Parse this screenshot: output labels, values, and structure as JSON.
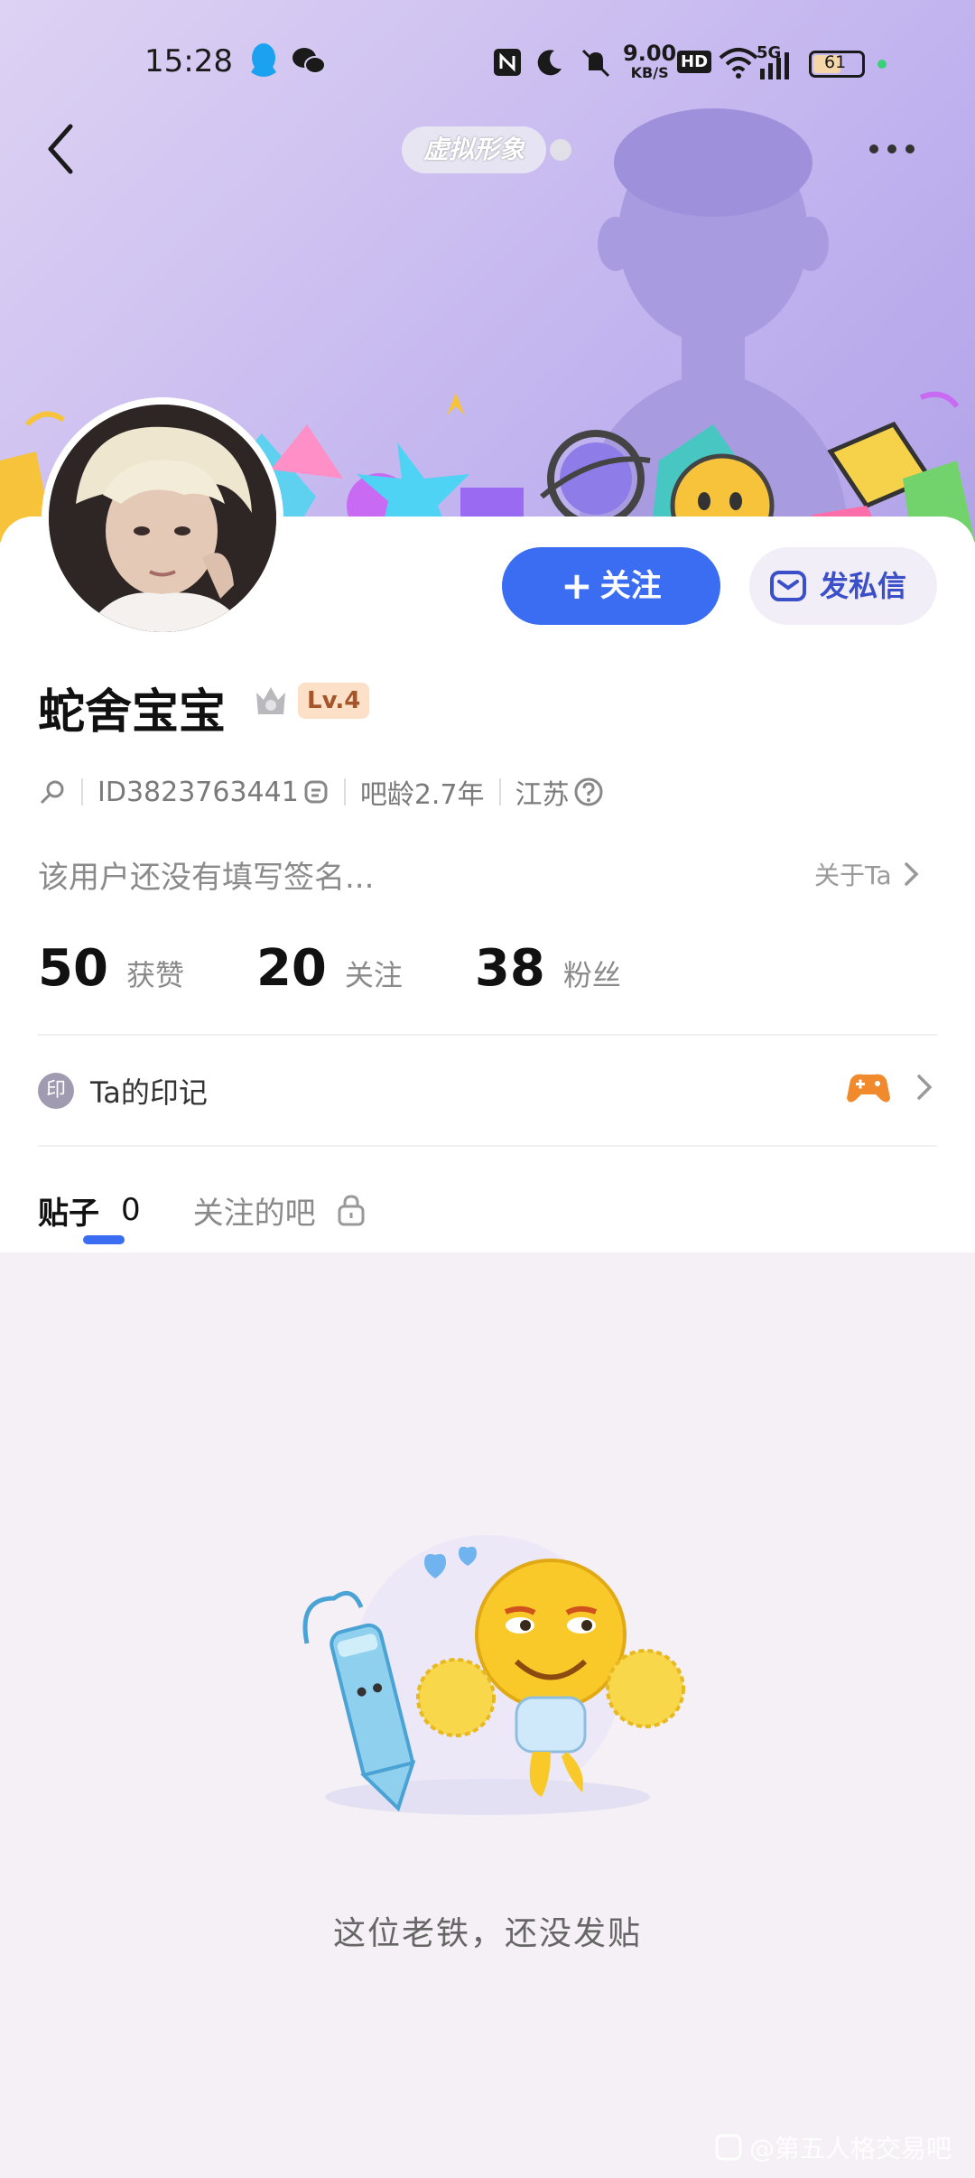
{
  "status_bar": {
    "time": "15:28",
    "network_speed": "9.00",
    "network_speed_unit": "KB/S",
    "hd_label": "HD",
    "signal_label": "5G",
    "battery": "61",
    "icons": [
      "qq-icon",
      "wechat-icon",
      "nfc-icon",
      "moon-icon",
      "mute-icon",
      "wifi-icon",
      "signal-icon",
      "battery-icon"
    ]
  },
  "header": {
    "avatar_pill": "虚拟形象"
  },
  "profile": {
    "username": "蛇舍宝宝",
    "level": "Lv.4",
    "id_text": "ID3823763441",
    "bar_age": "吧龄2.7年",
    "location": "江苏",
    "signature": "该用户还没有填写签名...",
    "about_link": "关于Ta"
  },
  "actions": {
    "follow_label": "关注",
    "message_label": "发私信"
  },
  "stats": [
    {
      "value": "50",
      "label": "获赞"
    },
    {
      "value": "20",
      "label": "关注"
    },
    {
      "value": "38",
      "label": "粉丝"
    }
  ],
  "imprint": {
    "badge": "印",
    "label": "Ta的印记"
  },
  "tabs": {
    "posts_label": "贴子",
    "posts_count": "0",
    "followed_bars_label": "关注的吧"
  },
  "empty_state": {
    "message": "这位老铁，还没发贴"
  },
  "watermark": "@第五人格交易吧",
  "colors": {
    "accent": "#3b6df2",
    "banner": "#c4b6ef",
    "level_badge_bg": "#fce0c8",
    "page_bg": "#f5f0f5"
  }
}
